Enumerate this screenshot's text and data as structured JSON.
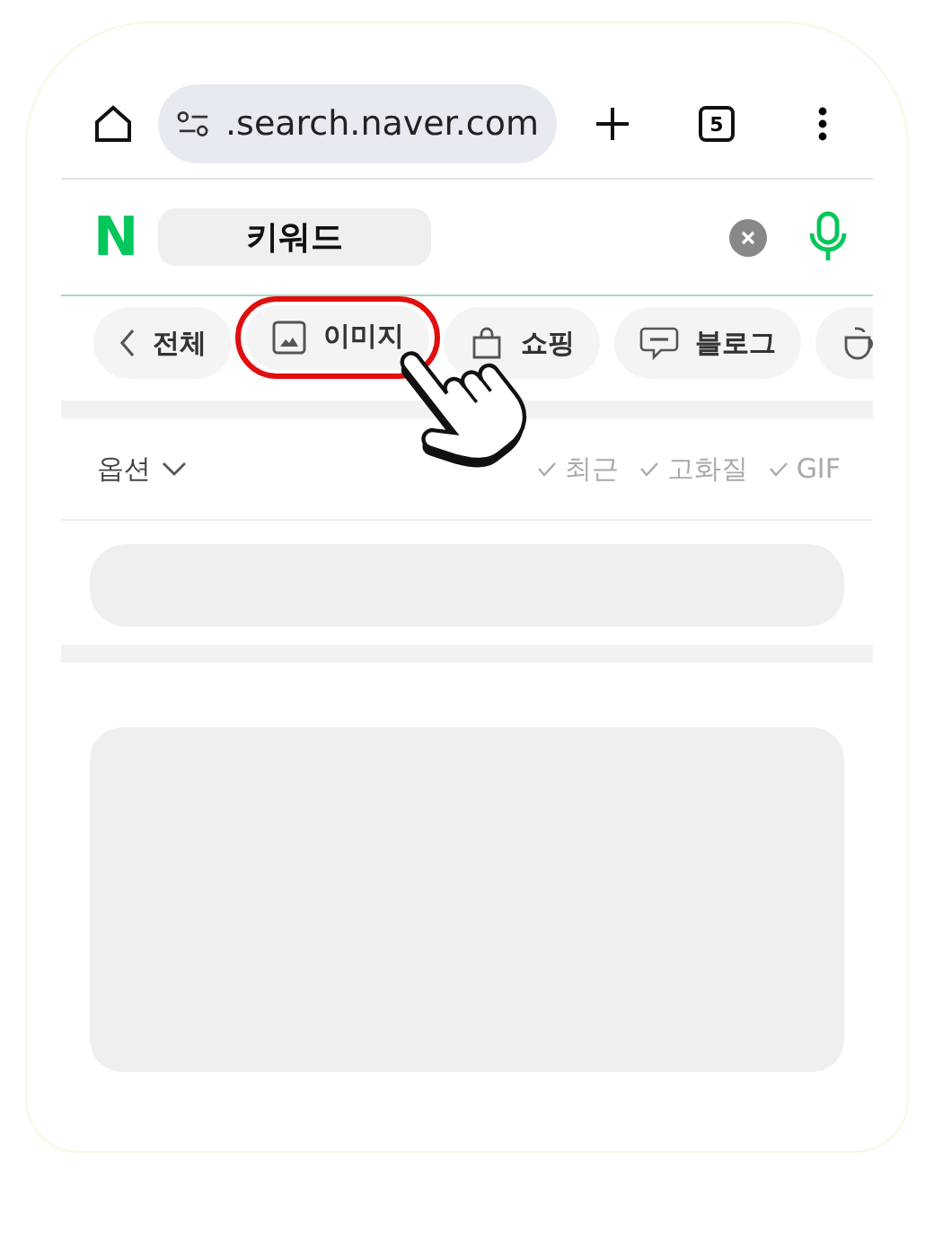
{
  "browser_bar": {
    "url": ".search.naver.com",
    "tab_count": "5"
  },
  "search": {
    "logo": "N",
    "value": "키워드"
  },
  "tabs": [
    {
      "kind": "back",
      "label": "전체",
      "selected": false,
      "circled": false
    },
    {
      "kind": "image",
      "label": "이미지",
      "selected": false,
      "circled": true
    },
    {
      "kind": "shopping",
      "label": "쇼핑",
      "selected": false,
      "circled": false
    },
    {
      "kind": "blog",
      "label": "블로그",
      "selected": false,
      "circled": false
    },
    {
      "kind": "cafe",
      "selected": false,
      "circled": false
    }
  ],
  "options": {
    "label": "옵션"
  },
  "filters": [
    {
      "label": "최근",
      "checked": false
    },
    {
      "label": "고화질",
      "checked": false
    },
    {
      "label": "GIF",
      "checked": false
    }
  ]
}
